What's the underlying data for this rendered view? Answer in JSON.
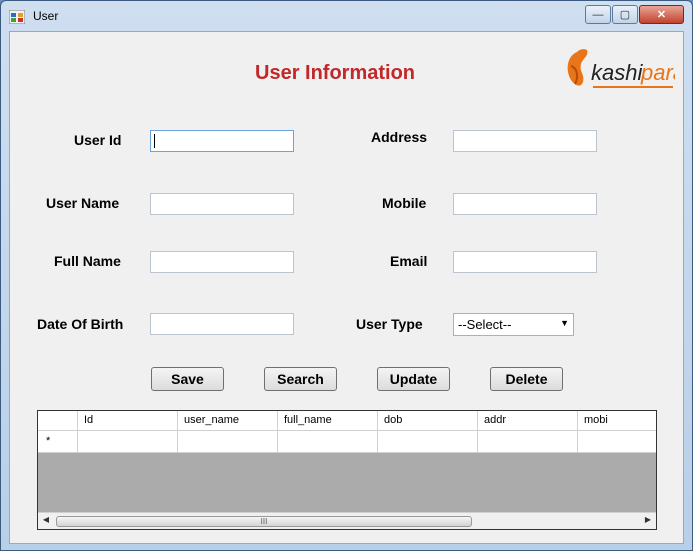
{
  "window": {
    "title": "User",
    "minimize_glyph": "—",
    "maximize_glyph": "▢",
    "close_glyph": "✕"
  },
  "heading": "User Information",
  "logo": {
    "text": "kashipara",
    "accent_color": "#e8751a"
  },
  "form": {
    "user_id_label": "User Id",
    "user_name_label": "User Name",
    "full_name_label": "Full Name",
    "dob_label": "Date Of Birth",
    "address_label": "Address",
    "mobile_label": "Mobile",
    "email_label": "Email",
    "user_type_label": "User Type",
    "user_type_selected": "--Select--"
  },
  "buttons": {
    "save": "Save",
    "search": "Search",
    "update": "Update",
    "delete": "Delete"
  },
  "grid": {
    "columns": [
      "Id",
      "user_name",
      "full_name",
      "dob",
      "addr",
      "mobi"
    ],
    "new_row_marker": "*",
    "scroll_grip": "III"
  },
  "colors": {
    "heading": "#c0282a",
    "grid_background": "#ababab"
  }
}
